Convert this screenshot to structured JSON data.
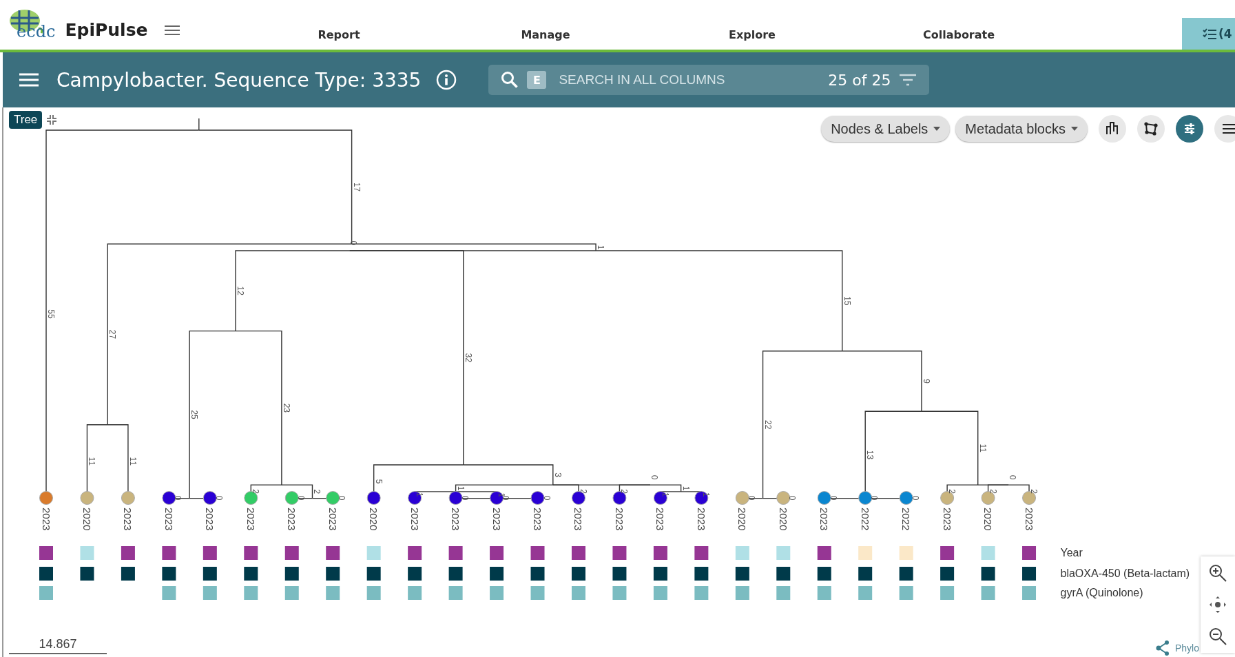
{
  "header": {
    "logo_text": "ecdc",
    "app_name": "EpiPulse",
    "nav": [
      {
        "label": "Report"
      },
      {
        "label": "Manage"
      },
      {
        "label": "Explore"
      },
      {
        "label": "Collaborate"
      }
    ],
    "tasks_tab": "(4"
  },
  "title_bar": {
    "title": "Campylobacter. Sequence Type: 3335"
  },
  "search": {
    "badge": "E",
    "placeholder": "SEARCH IN ALL COLUMNS",
    "count": "25 of 25"
  },
  "tree_badge": "Tree",
  "toolbar": {
    "dropdowns": [
      {
        "label": "Nodes & Labels"
      },
      {
        "label": "Metadata blocks"
      }
    ],
    "icons": [
      {
        "kind": "layout",
        "selected": false
      },
      {
        "kind": "network",
        "selected": false
      },
      {
        "kind": "sliders",
        "selected": true
      },
      {
        "kind": "menu",
        "selected": false
      }
    ]
  },
  "tree": {
    "children": [
      {
        "branch": "55",
        "year": "2023",
        "color": "#d97b2c",
        "blocks": [
          {
            "color": "#963694"
          },
          {
            "color": "#003a4a"
          },
          {
            "color": "#7bbcc1"
          }
        ]
      },
      {
        "branch": "17",
        "children": [
          {
            "branch": "27",
            "children": [
              {
                "branch": "11",
                "year": "2020",
                "color": "#c9b47e",
                "blocks": [
                  {
                    "color": "#b0e0e6"
                  },
                  {
                    "color": "#003a4a"
                  }
                ]
              },
              {
                "branch": "11",
                "year": "2023",
                "color": "#c9b47e",
                "blocks": [
                  {
                    "color": "#963694"
                  },
                  {
                    "color": "#003a4a"
                  }
                ]
              }
            ]
          },
          {
            "branch": "1",
            "children": [
              {
                "branch": "0",
                "children": [
                  {
                    "branch": "12",
                    "children": [
                      {
                        "branch": "25",
                        "children": [
                          {
                            "branch": "0",
                            "year": "2023",
                            "color": "#2a00d4",
                            "blocks": [
                              {
                                "color": "#963694"
                              },
                              {
                                "color": "#003a4a"
                              },
                              {
                                "color": "#7bbcc1"
                              }
                            ]
                          },
                          {
                            "branch": "0",
                            "year": "2023",
                            "color": "#2a00d4",
                            "blocks": [
                              {
                                "color": "#963694"
                              },
                              {
                                "color": "#003a4a"
                              },
                              {
                                "color": "#7bbcc1"
                              }
                            ]
                          }
                        ]
                      },
                      {
                        "branch": "23",
                        "children": [
                          {
                            "branch": "2",
                            "year": "2023",
                            "color": "#33cc66",
                            "blocks": [
                              {
                                "color": "#963694"
                              },
                              {
                                "color": "#003a4a"
                              },
                              {
                                "color": "#7bbcc1"
                              }
                            ]
                          },
                          {
                            "branch": "2",
                            "children": [
                              {
                                "branch": "0",
                                "year": "2023",
                                "color": "#33cc66",
                                "blocks": [
                                  {
                                    "color": "#963694"
                                  },
                                  {
                                    "color": "#003a4a"
                                  },
                                  {
                                    "color": "#7bbcc1"
                                  }
                                ]
                              },
                              {
                                "branch": "0",
                                "year": "2023",
                                "color": "#33cc66",
                                "blocks": [
                                  {
                                    "color": "#963694"
                                  },
                                  {
                                    "color": "#003a4a"
                                  },
                                  {
                                    "color": "#7bbcc1"
                                  }
                                ]
                              }
                            ]
                          }
                        ]
                      }
                    ]
                  },
                  {
                    "branch": "32",
                    "children": [
                      {
                        "branch": "5",
                        "year": "2020",
                        "color": "#2a00d4",
                        "blocks": [
                          {
                            "color": "#b0e0e6"
                          },
                          {
                            "color": "#003a4a"
                          },
                          {
                            "color": "#7bbcc1"
                          }
                        ]
                      },
                      {
                        "branch": "3",
                        "children": [
                          {
                            "branch": "1",
                            "children": [
                              {
                                "branch": "1",
                                "year": "2023",
                                "color": "#2a00d4",
                                "blocks": [
                                  {
                                    "color": "#963694"
                                  },
                                  {
                                    "color": "#003a4a"
                                  },
                                  {
                                    "color": "#7bbcc1"
                                  }
                                ]
                              },
                              {
                                "branch": "1",
                                "children": [
                                  {
                                    "branch": "0",
                                    "year": "2023",
                                    "color": "#2a00d4",
                                    "blocks": [
                                      {
                                        "color": "#963694"
                                      },
                                      {
                                        "color": "#003a4a"
                                      },
                                      {
                                        "color": "#7bbcc1"
                                      }
                                    ]
                                  },
                                  {
                                    "branch": "0",
                                    "year": "2023",
                                    "color": "#2a00d4",
                                    "blocks": [
                                      {
                                        "color": "#963694"
                                      },
                                      {
                                        "color": "#003a4a"
                                      },
                                      {
                                        "color": "#7bbcc1"
                                      }
                                    ]
                                  },
                                  {
                                    "branch": "0",
                                    "year": "2023",
                                    "color": "#2a00d4",
                                    "blocks": [
                                      {
                                        "color": "#963694"
                                      },
                                      {
                                        "color": "#003a4a"
                                      },
                                      {
                                        "color": "#7bbcc1"
                                      }
                                    ]
                                  }
                                ]
                              }
                            ]
                          },
                          {
                            "branch": "2",
                            "year": "2023",
                            "color": "#2a00d4",
                            "blocks": [
                              {
                                "color": "#963694"
                              },
                              {
                                "color": "#003a4a"
                              },
                              {
                                "color": "#7bbcc1"
                              }
                            ]
                          },
                          {
                            "branch": "0",
                            "children": [
                              {
                                "branch": "2",
                                "year": "2023",
                                "color": "#2a00d4",
                                "blocks": [
                                  {
                                    "color": "#963694"
                                  },
                                  {
                                    "color": "#003a4a"
                                  },
                                  {
                                    "color": "#7bbcc1"
                                  }
                                ]
                              },
                              {
                                "branch": "1",
                                "children": [
                                  {
                                    "branch": "1",
                                    "year": "2023",
                                    "color": "#2a00d4",
                                    "blocks": [
                                      {
                                        "color": "#963694"
                                      },
                                      {
                                        "color": "#003a4a"
                                      },
                                      {
                                        "color": "#7bbcc1"
                                      }
                                    ]
                                  },
                                  {
                                    "branch": "1",
                                    "year": "2023",
                                    "color": "#2a00d4",
                                    "blocks": [
                                      {
                                        "color": "#963694"
                                      },
                                      {
                                        "color": "#003a4a"
                                      },
                                      {
                                        "color": "#7bbcc1"
                                      }
                                    ]
                                  }
                                ]
                              }
                            ]
                          }
                        ]
                      }
                    ]
                  }
                ]
              },
              {
                "branch": "15",
                "children": [
                  {
                    "branch": "22",
                    "children": [
                      {
                        "branch": "0",
                        "year": "2020",
                        "color": "#c9b47e",
                        "blocks": [
                          {
                            "color": "#b0e0e6"
                          },
                          {
                            "color": "#003a4a"
                          },
                          {
                            "color": "#7bbcc1"
                          }
                        ]
                      },
                      {
                        "branch": "0",
                        "year": "2020",
                        "color": "#c9b47e",
                        "blocks": [
                          {
                            "color": "#b0e0e6"
                          },
                          {
                            "color": "#003a4a"
                          },
                          {
                            "color": "#7bbcc1"
                          }
                        ]
                      }
                    ]
                  },
                  {
                    "branch": "9",
                    "children": [
                      {
                        "branch": "13",
                        "children": [
                          {
                            "branch": "0",
                            "year": "2023",
                            "color": "#0a86d0",
                            "blocks": [
                              {
                                "color": "#963694"
                              },
                              {
                                "color": "#003a4a"
                              },
                              {
                                "color": "#7bbcc1"
                              }
                            ]
                          },
                          {
                            "branch": "0",
                            "year": "2022",
                            "color": "#0a86d0",
                            "blocks": [
                              {
                                "color": "#fbe8c8"
                              },
                              {
                                "color": "#003a4a"
                              },
                              {
                                "color": "#7bbcc1"
                              }
                            ]
                          },
                          {
                            "branch": "0",
                            "year": "2022",
                            "color": "#0a86d0",
                            "blocks": [
                              {
                                "color": "#fbe8c8"
                              },
                              {
                                "color": "#003a4a"
                              },
                              {
                                "color": "#7bbcc1"
                              }
                            ]
                          }
                        ]
                      },
                      {
                        "branch": "11",
                        "children": [
                          {
                            "branch": "2",
                            "year": "2023",
                            "color": "#c9b47e",
                            "blocks": [
                              {
                                "color": "#963694"
                              },
                              {
                                "color": "#003a4a"
                              },
                              {
                                "color": "#7bbcc1"
                              }
                            ]
                          },
                          {
                            "branch": "0",
                            "children": [
                              {
                                "branch": "2",
                                "year": "2020",
                                "color": "#c9b47e",
                                "blocks": [
                                  {
                                    "color": "#b0e0e6"
                                  },
                                  {
                                    "color": "#003a4a"
                                  },
                                  {
                                    "color": "#7bbcc1"
                                  }
                                ]
                              },
                              {
                                "branch": "2",
                                "year": "2023",
                                "color": "#c9b47e",
                                "blocks": [
                                  {
                                    "color": "#963694"
                                  },
                                  {
                                    "color": "#003a4a"
                                  },
                                  {
                                    "color": "#7bbcc1"
                                  }
                                ]
                              }
                            ]
                          }
                        ]
                      }
                    ]
                  }
                ]
              }
            ]
          }
        ]
      }
    ]
  },
  "metadata_legend": [
    {
      "label": "Year"
    },
    {
      "label": "blaOXA-450 (Beta-lactam)"
    },
    {
      "label": "gyrA (Quinolone)"
    }
  ],
  "scale_bar": "14.867",
  "credit": "Phylo"
}
